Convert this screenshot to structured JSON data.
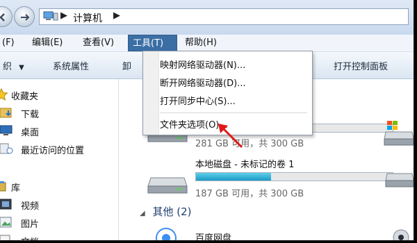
{
  "address": {
    "crumbs": [
      "计算机"
    ]
  },
  "menubar": {
    "items": [
      "(F)",
      "编辑(E)",
      "查看(V)",
      "工具(T)",
      "帮助(H)"
    ],
    "active": "工具(T)"
  },
  "toolbar": {
    "organize": "织",
    "system_props": "系统属性",
    "cut_off": "卸",
    "control_panel": "打开控制面板"
  },
  "tools_menu": {
    "items": [
      "映射网络驱动器(N)...",
      "断开网络驱动器(D)...",
      "打开同步中心(S)...",
      "文件夹选项(O)..."
    ]
  },
  "navigation": {
    "items": [
      {
        "label": "收藏夹",
        "icon": "star-icon"
      },
      {
        "label": "下载",
        "icon": "download-folder-icon"
      },
      {
        "label": "桌面",
        "icon": "desktop-icon"
      },
      {
        "label": "最近访问的位置",
        "icon": "recent-places-icon"
      },
      {
        "label": "库",
        "icon": "library-icon"
      },
      {
        "label": "视频",
        "icon": "video-icon"
      },
      {
        "label": "图片",
        "icon": "picture-icon"
      },
      {
        "label": "文档",
        "icon": "document-icon"
      }
    ]
  },
  "drives": [
    {
      "name": "",
      "space": "281 GB 可用，共 300 GB",
      "used_fraction": 0.06
    },
    {
      "name": "本地磁盘 - 未标记的卷 1",
      "space": "187 GB 可用，共 300 GB",
      "used_fraction": 0.38
    }
  ],
  "other_group": {
    "label": "其他 (2)"
  },
  "other_items": [
    {
      "name": "百度网盘"
    }
  ],
  "colors": {
    "menu_active": "#3a6ea5",
    "usage_bar": "#1a9ac7",
    "annotation_arrow": "#e01818"
  }
}
